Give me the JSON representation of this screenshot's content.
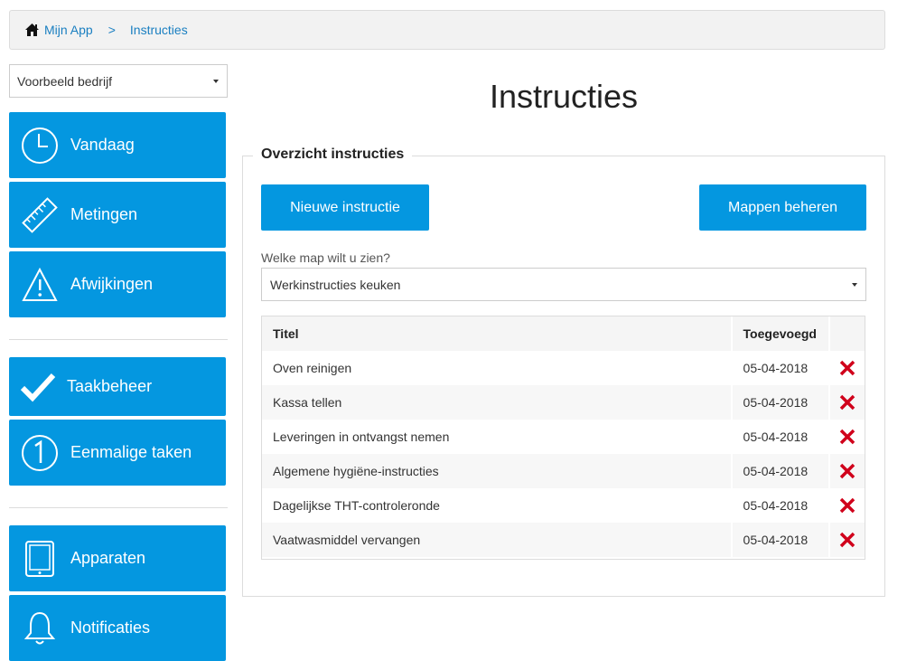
{
  "breadcrumb": {
    "home_icon": "home-icon",
    "home_label": "Mijn App",
    "separator": ">",
    "current": "Instructies"
  },
  "company_select": {
    "value": "Voorbeeld bedrijf"
  },
  "sidebar": {
    "items": [
      {
        "label": "Vandaag",
        "icon": "clock-icon"
      },
      {
        "label": "Metingen",
        "icon": "ruler-icon"
      },
      {
        "label": "Afwijkingen",
        "icon": "warning-icon"
      },
      {
        "label": "Taakbeheer",
        "icon": "checkmark-icon"
      },
      {
        "label": "Eenmalige taken",
        "icon": "one-icon"
      },
      {
        "label": "Apparaten",
        "icon": "tablet-icon"
      },
      {
        "label": "Notificaties",
        "icon": "bell-icon"
      }
    ]
  },
  "page": {
    "title": "Instructies"
  },
  "panel": {
    "legend": "Overzicht instructies",
    "new_button": "Nieuwe instructie",
    "folders_button": "Mappen beheren",
    "folder_label": "Welke map wilt u zien?",
    "folder_value": "Werkinstructies keuken"
  },
  "table": {
    "headers": {
      "title": "Titel",
      "added": "Toegevoegd"
    },
    "rows": [
      {
        "title": "Oven reinigen",
        "added": "05-04-2018"
      },
      {
        "title": "Kassa tellen",
        "added": "05-04-2018"
      },
      {
        "title": "Leveringen in ontvangst nemen",
        "added": "05-04-2018"
      },
      {
        "title": "Algemene hygiëne-instructies",
        "added": "05-04-2018"
      },
      {
        "title": "Dagelijkse THT-controleronde",
        "added": "05-04-2018"
      },
      {
        "title": "Vaatwasmiddel vervangen",
        "added": "05-04-2018"
      }
    ],
    "delete_icon": "delete-icon"
  },
  "colors": {
    "accent": "#0497e0",
    "link": "#1a7fc1",
    "delete": "#d0021b"
  }
}
